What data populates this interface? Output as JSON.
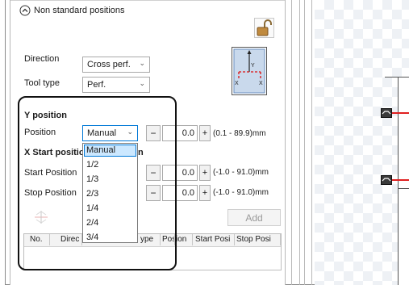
{
  "section": {
    "title": "Non standard positions"
  },
  "direction": {
    "label": "Direction",
    "value": "Cross perf."
  },
  "tool_type": {
    "label": "Tool type",
    "value": "Perf."
  },
  "diagram": {
    "y_label": "Y",
    "x_label": "X"
  },
  "y_position": {
    "heading": "Y position",
    "position_label": "Position",
    "mode_value": "Manual",
    "minus": "−",
    "plus": "+",
    "value": "0.0",
    "range": "(0.1 - 89.9)mm"
  },
  "x_start_position": {
    "heading_visible": "X Start positio",
    "heading_tail": "n",
    "start_label": "Start Position",
    "start_value": "0.0",
    "start_range": "(-1.0 - 91.0)mm",
    "stop_label": "Stop Position",
    "stop_value": "0.0",
    "stop_range": "(-1.0 - 91.0)mm"
  },
  "add_button": "Add",
  "table": {
    "headers": [
      "No.",
      "Direc",
      "ype",
      "Pos",
      "ion",
      "Start Posi",
      "Stop Posi"
    ]
  },
  "dropdown": {
    "options": [
      "Manual",
      "1/2",
      "1/3",
      "2/3",
      "1/4",
      "2/4",
      "3/4"
    ],
    "selected": "Manual"
  },
  "colors": {
    "accent": "#0078d7",
    "highlight": "#cce8ff",
    "lock": "#c08a3e",
    "marker": "#e02020"
  }
}
